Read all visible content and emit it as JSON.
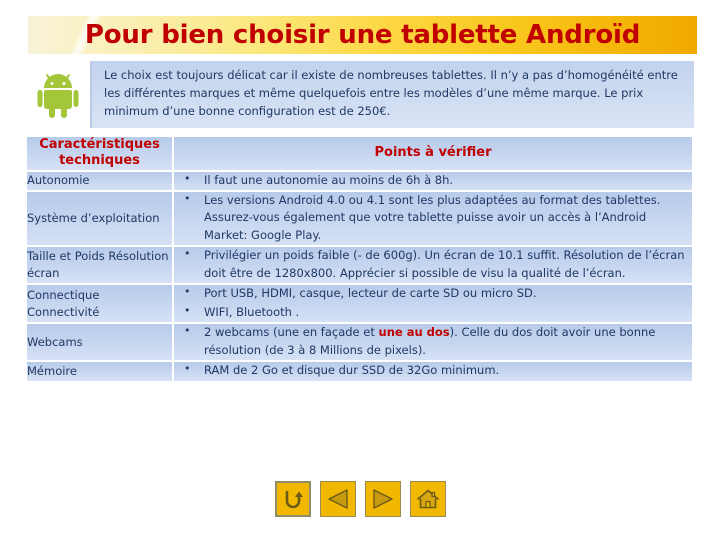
{
  "slide": {
    "title": "Pour bien choisir une tablette Androïd",
    "intro_logo": "android-robot-logo",
    "intro_text": "Le choix est toujours délicat car  il existe de nombreuses tablettes. Il n’y a pas d’homogénéité entre les différentes marques et même quelquefois entre les modèles d’une même marque. Le prix minimum d’une bonne configuration est de 250€."
  },
  "table": {
    "headers": {
      "feature": "Caractéristiques techniques",
      "points": "Points à vérifier"
    },
    "rows": [
      {
        "feature": "Autonomie",
        "points": [
          {
            "pre": "Il faut une autonomie au moins de 6h à 8h.",
            "hl": "",
            "post": ""
          }
        ]
      },
      {
        "feature": "Système d’exploitation",
        "points": [
          {
            "pre": "Les versions Android 4.0 ou 4.1 sont les plus adaptées au format des tablettes. Assurez-vous également que votre tablette puisse avoir un accès à l’Android Market:  Google Play.",
            "hl": "",
            "post": ""
          }
        ]
      },
      {
        "feature": "Taille et Poids Résolution écran",
        "points": [
          {
            "pre": "Privilégier un poids faible (- de 600g). Un écran de 10.1 suffit. Résolution de l’écran doit être de 1280x800. Apprécier si possible de visu la qualité de l’écran.",
            "hl": "",
            "post": ""
          }
        ]
      },
      {
        "feature": "Connectique Connectivité",
        "points": [
          {
            "pre": "Port USB, HDMI, casque,  lecteur de carte SD ou micro  SD.",
            "hl": "",
            "post": ""
          },
          {
            "pre": "WIFI, Bluetooth .",
            "hl": "",
            "post": ""
          }
        ]
      },
      {
        "feature": "Webcams",
        "points": [
          {
            "pre": "2 webcams (une en façade et ",
            "hl": "une au dos",
            "post": "). Celle du dos doit avoir une bonne résolution (de 3 à 8 Millions de pixels)."
          }
        ]
      },
      {
        "feature": "Mémoire",
        "points": [
          {
            "pre": "RAM de 2 Go et disque dur SSD de 32Go minimum.",
            "hl": "",
            "post": ""
          }
        ]
      }
    ]
  },
  "nav": {
    "buttons": [
      {
        "name": "return-button",
        "icon": "return-arrow-icon",
        "label": "Retour"
      },
      {
        "name": "previous-button",
        "icon": "triangle-left-icon",
        "label": "Précédent"
      },
      {
        "name": "next-button",
        "icon": "triangle-right-icon",
        "label": "Suivant"
      },
      {
        "name": "home-button",
        "icon": "home-icon",
        "label": "Accueil"
      }
    ]
  },
  "colors": {
    "title_text": "#C00000",
    "banner_start": "#F7F3D8",
    "banner_end": "#F0A800",
    "table_blue": "#C4D4EF",
    "body_text": "#1F3864",
    "nav_yellow": "#F2B800"
  }
}
